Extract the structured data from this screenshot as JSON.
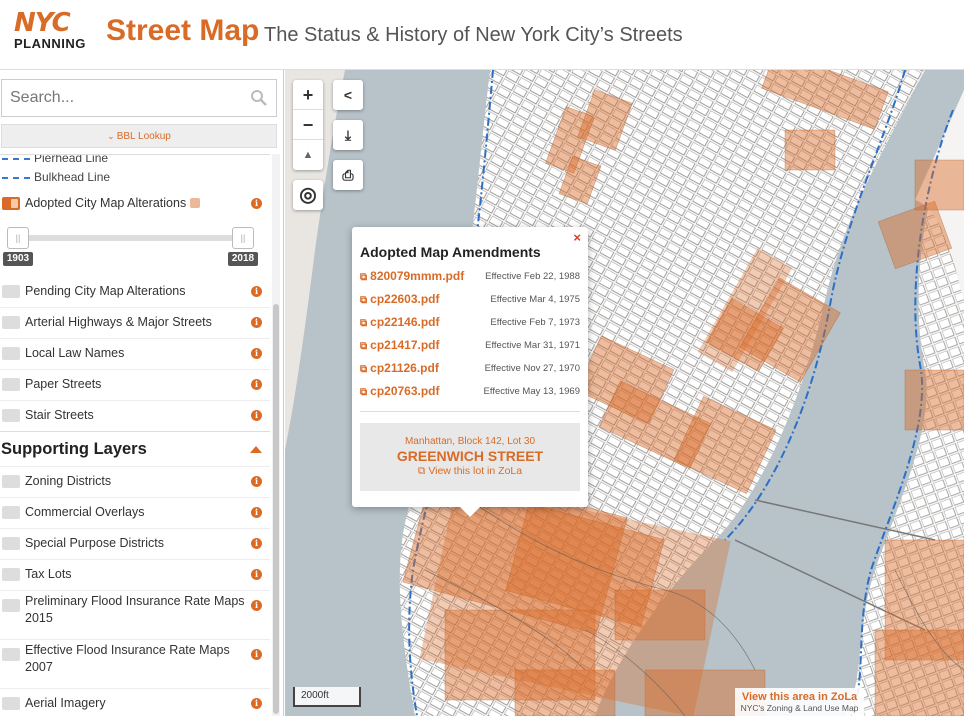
{
  "header": {
    "logo_top": "NYC",
    "logo_bottom": "PLANNING",
    "title": "Street Map",
    "subtitle": "The Status & History of New York City’s Streets"
  },
  "sidebar": {
    "search_placeholder": "Search...",
    "bbl_lookup": "BBL Lookup",
    "legend_lines": [
      {
        "label": "Pierhead Line"
      },
      {
        "label": "Bulkhead Line"
      }
    ],
    "adopted_layer": {
      "label": "Adopted City Map Alterations",
      "checked": true
    },
    "slider": {
      "min_label": "1903",
      "max_label": "2018"
    },
    "layers": [
      {
        "label": "Pending City Map Alterations",
        "checked": false
      },
      {
        "label": "Arterial Highways & Major Streets",
        "checked": false
      },
      {
        "label": "Local Law Names",
        "checked": false
      },
      {
        "label": "Paper Streets",
        "checked": false
      },
      {
        "label": "Stair Streets",
        "checked": false
      }
    ],
    "supporting_title": "Supporting Layers",
    "supporting_layers": [
      {
        "label": "Zoning Districts",
        "checked": false
      },
      {
        "label": "Commercial Overlays",
        "checked": false
      },
      {
        "label": "Special Purpose Districts",
        "checked": false
      },
      {
        "label": "Tax Lots",
        "checked": false
      },
      {
        "label": "Preliminary Flood Insurance Rate Maps 2015",
        "checked": false
      },
      {
        "label": "Effective Flood Insurance Rate Maps 2007",
        "checked": false
      },
      {
        "label": "Aerial Imagery",
        "checked": false
      }
    ],
    "info_glyph": "i"
  },
  "map": {
    "controls": {
      "zoom_in": "+",
      "zoom_out": "−",
      "compass": "▲",
      "locate": "◎",
      "share": "<",
      "download": "⤓",
      "print": "⎙"
    },
    "scale_label": "2000ft",
    "zola_link": "View this area in ZoLa",
    "zola_sub": "NYC's Zoning & Land Use Map",
    "colors": {
      "water": "#b7c3c9",
      "land": "#f4f1ee",
      "alteration": "#d96b27",
      "accent": "#d96b27"
    }
  },
  "popup": {
    "title": "Adopted Map Amendments",
    "close": "×",
    "amendments": [
      {
        "file": "820079mmm.pdf",
        "effective": "Effective Feb 22, 1988"
      },
      {
        "file": "cp22603.pdf",
        "effective": "Effective Mar 4, 1975"
      },
      {
        "file": "cp22146.pdf",
        "effective": "Effective Feb 7, 1973"
      },
      {
        "file": "cp21417.pdf",
        "effective": "Effective Mar 31, 1971"
      },
      {
        "file": "cp21126.pdf",
        "effective": "Effective Nov 27, 1970"
      },
      {
        "file": "cp20763.pdf",
        "effective": "Effective May 13, 1969"
      }
    ],
    "lot": {
      "meta": "Manhattan, Block 142, Lot 30",
      "street": "GREENWICH STREET",
      "view_label": "View this lot in ZoLa"
    }
  }
}
